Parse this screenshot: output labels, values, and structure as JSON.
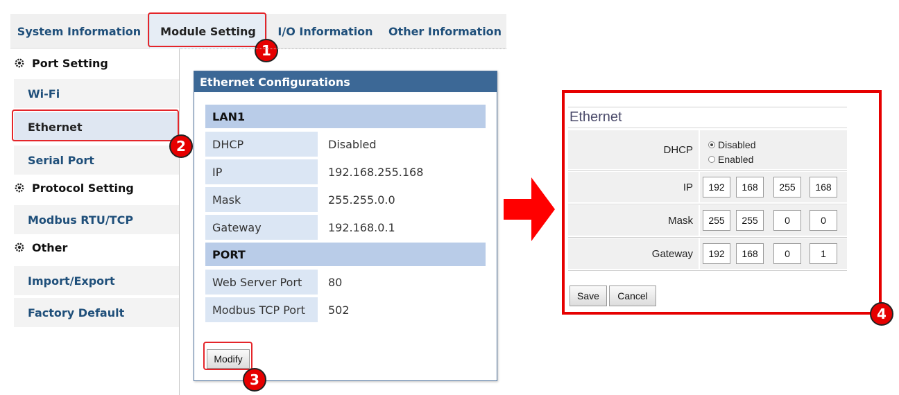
{
  "tabs": [
    {
      "label": "System Information",
      "active": false
    },
    {
      "label": "Module Setting",
      "active": true
    },
    {
      "label": "I/O Information",
      "active": false
    },
    {
      "label": "Other Information",
      "active": false
    }
  ],
  "sidebar": {
    "sections": [
      {
        "title": "Port Setting",
        "icon": "gear-icon",
        "items": [
          "Wi-Fi",
          "Ethernet",
          "Serial Port"
        ]
      },
      {
        "title": "Protocol Setting",
        "icon": "gear-icon",
        "items": [
          "Modbus RTU/TCP"
        ]
      },
      {
        "title": "Other",
        "icon": "gear-icon",
        "items": [
          "Import/Export",
          "Factory Default"
        ]
      }
    ],
    "active_item": "Ethernet"
  },
  "dialog": {
    "title": "Ethernet Configurations",
    "lan": {
      "header": "LAN1",
      "rows": [
        {
          "label": "DHCP",
          "value": "Disabled"
        },
        {
          "label": "IP",
          "value": "192.168.255.168"
        },
        {
          "label": "Mask",
          "value": "255.255.0.0"
        },
        {
          "label": "Gateway",
          "value": "192.168.0.1"
        }
      ]
    },
    "port": {
      "header": "PORT",
      "rows": [
        {
          "label": "Web Server Port",
          "value": "80"
        },
        {
          "label": "Modbus TCP Port",
          "value": "502"
        }
      ]
    },
    "modify_label": "Modify"
  },
  "edit_panel": {
    "title": "Ethernet",
    "dhcp": {
      "label": "DHCP",
      "options": [
        "Disabled",
        "Enabled"
      ],
      "selected": "Disabled"
    },
    "ip": {
      "label": "IP",
      "octets": [
        "192",
        "168",
        "255",
        "168"
      ]
    },
    "mask": {
      "label": "Mask",
      "octets": [
        "255",
        "255",
        "0",
        "0"
      ]
    },
    "gateway": {
      "label": "Gateway",
      "octets": [
        "192",
        "168",
        "0",
        "1"
      ]
    },
    "save_label": "Save",
    "cancel_label": "Cancel"
  },
  "callouts": [
    "1",
    "2",
    "3",
    "4"
  ],
  "colors": {
    "highlight": "#e4252a",
    "callout": "#e60000",
    "dialog_header": "#3c6896",
    "group_header": "#b9cce8",
    "arrow": "#ff0000"
  }
}
